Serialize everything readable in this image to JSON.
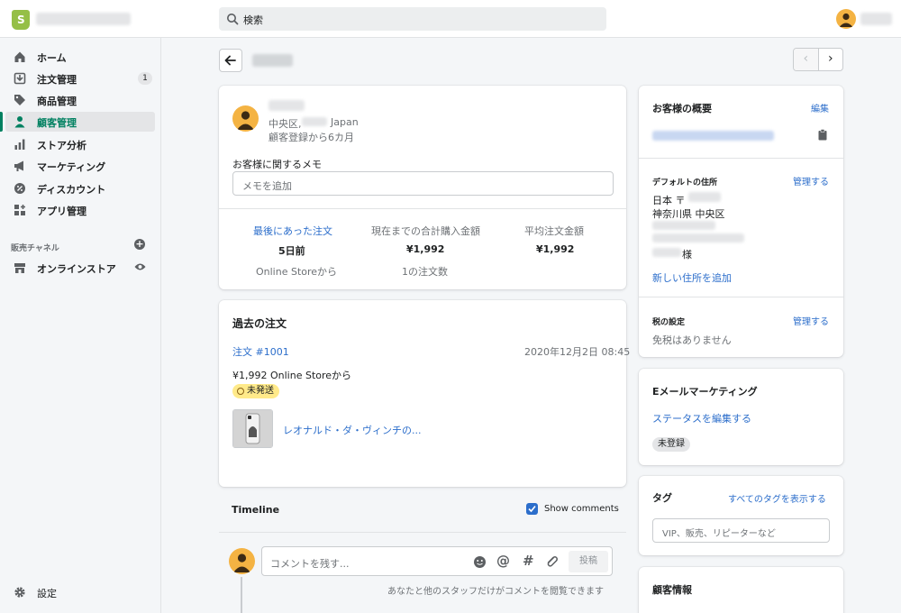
{
  "topbar": {
    "search_placeholder": "検索"
  },
  "sidebar": {
    "items": [
      {
        "label": "ホーム"
      },
      {
        "label": "注文管理",
        "badge": "1"
      },
      {
        "label": "商品管理"
      },
      {
        "label": "顧客管理"
      },
      {
        "label": "ストア分析"
      },
      {
        "label": "マーケティング"
      },
      {
        "label": "ディスカウント"
      },
      {
        "label": "アプリ管理"
      }
    ],
    "sales_channels_header": "販売チャネル",
    "online_store": "オンラインストア",
    "settings": "設定"
  },
  "customer": {
    "location_prefix": "中央区,",
    "location_country": "Japan",
    "since": "顧客登録から6カ月",
    "memo_label": "お客様に関するメモ",
    "memo_placeholder": "メモを追加",
    "stats": {
      "last_order_label": "最後にあった注文",
      "last_order_value": "5日前",
      "last_order_sub": "Online Storeから",
      "total_label": "現在までの合計購入金額",
      "total_value": "¥1,992",
      "total_sub": "1の注文数",
      "avg_label": "平均注文金額",
      "avg_value": "¥1,992"
    }
  },
  "orders": {
    "title": "過去の注文",
    "order_link": "注文 #1001",
    "order_date": "2020年12月2日 08:45",
    "amount_line": "¥1,992 Online Storeから",
    "status": "未発送",
    "product_name": "レオナルド・ダ・ヴィンチの..."
  },
  "timeline": {
    "title": "Timeline",
    "show_comments": "Show comments",
    "comment_placeholder": "コメントを残す...",
    "post_button": "投稿",
    "note": "あなたと他のスタッフだけがコメントを閲覧できます"
  },
  "overview": {
    "title": "お客様の概要",
    "edit": "編集",
    "default_address_label": "デフォルトの住所",
    "manage": "管理する",
    "address_line1": "日本 〒",
    "address_line2": "神奈川県 中央区",
    "address_suffix": "様",
    "add_address": "新しい住所を追加",
    "tax_label": "税の設定",
    "tax_manage": "管理する",
    "tax_value": "免税はありません"
  },
  "email_marketing": {
    "title": "Eメールマーケティング",
    "edit_status": "ステータスを編集する",
    "status": "未登録"
  },
  "tags": {
    "title": "タグ",
    "view_all": "すべてのタグを表示する",
    "placeholder": "VIP、販売、リピーターなど"
  },
  "customer_info": {
    "title": "顧客情報"
  },
  "colors": {
    "accent": "#008060",
    "link": "#2c6ecb",
    "avatar": "#f4b343",
    "status": "#ffea8a"
  }
}
